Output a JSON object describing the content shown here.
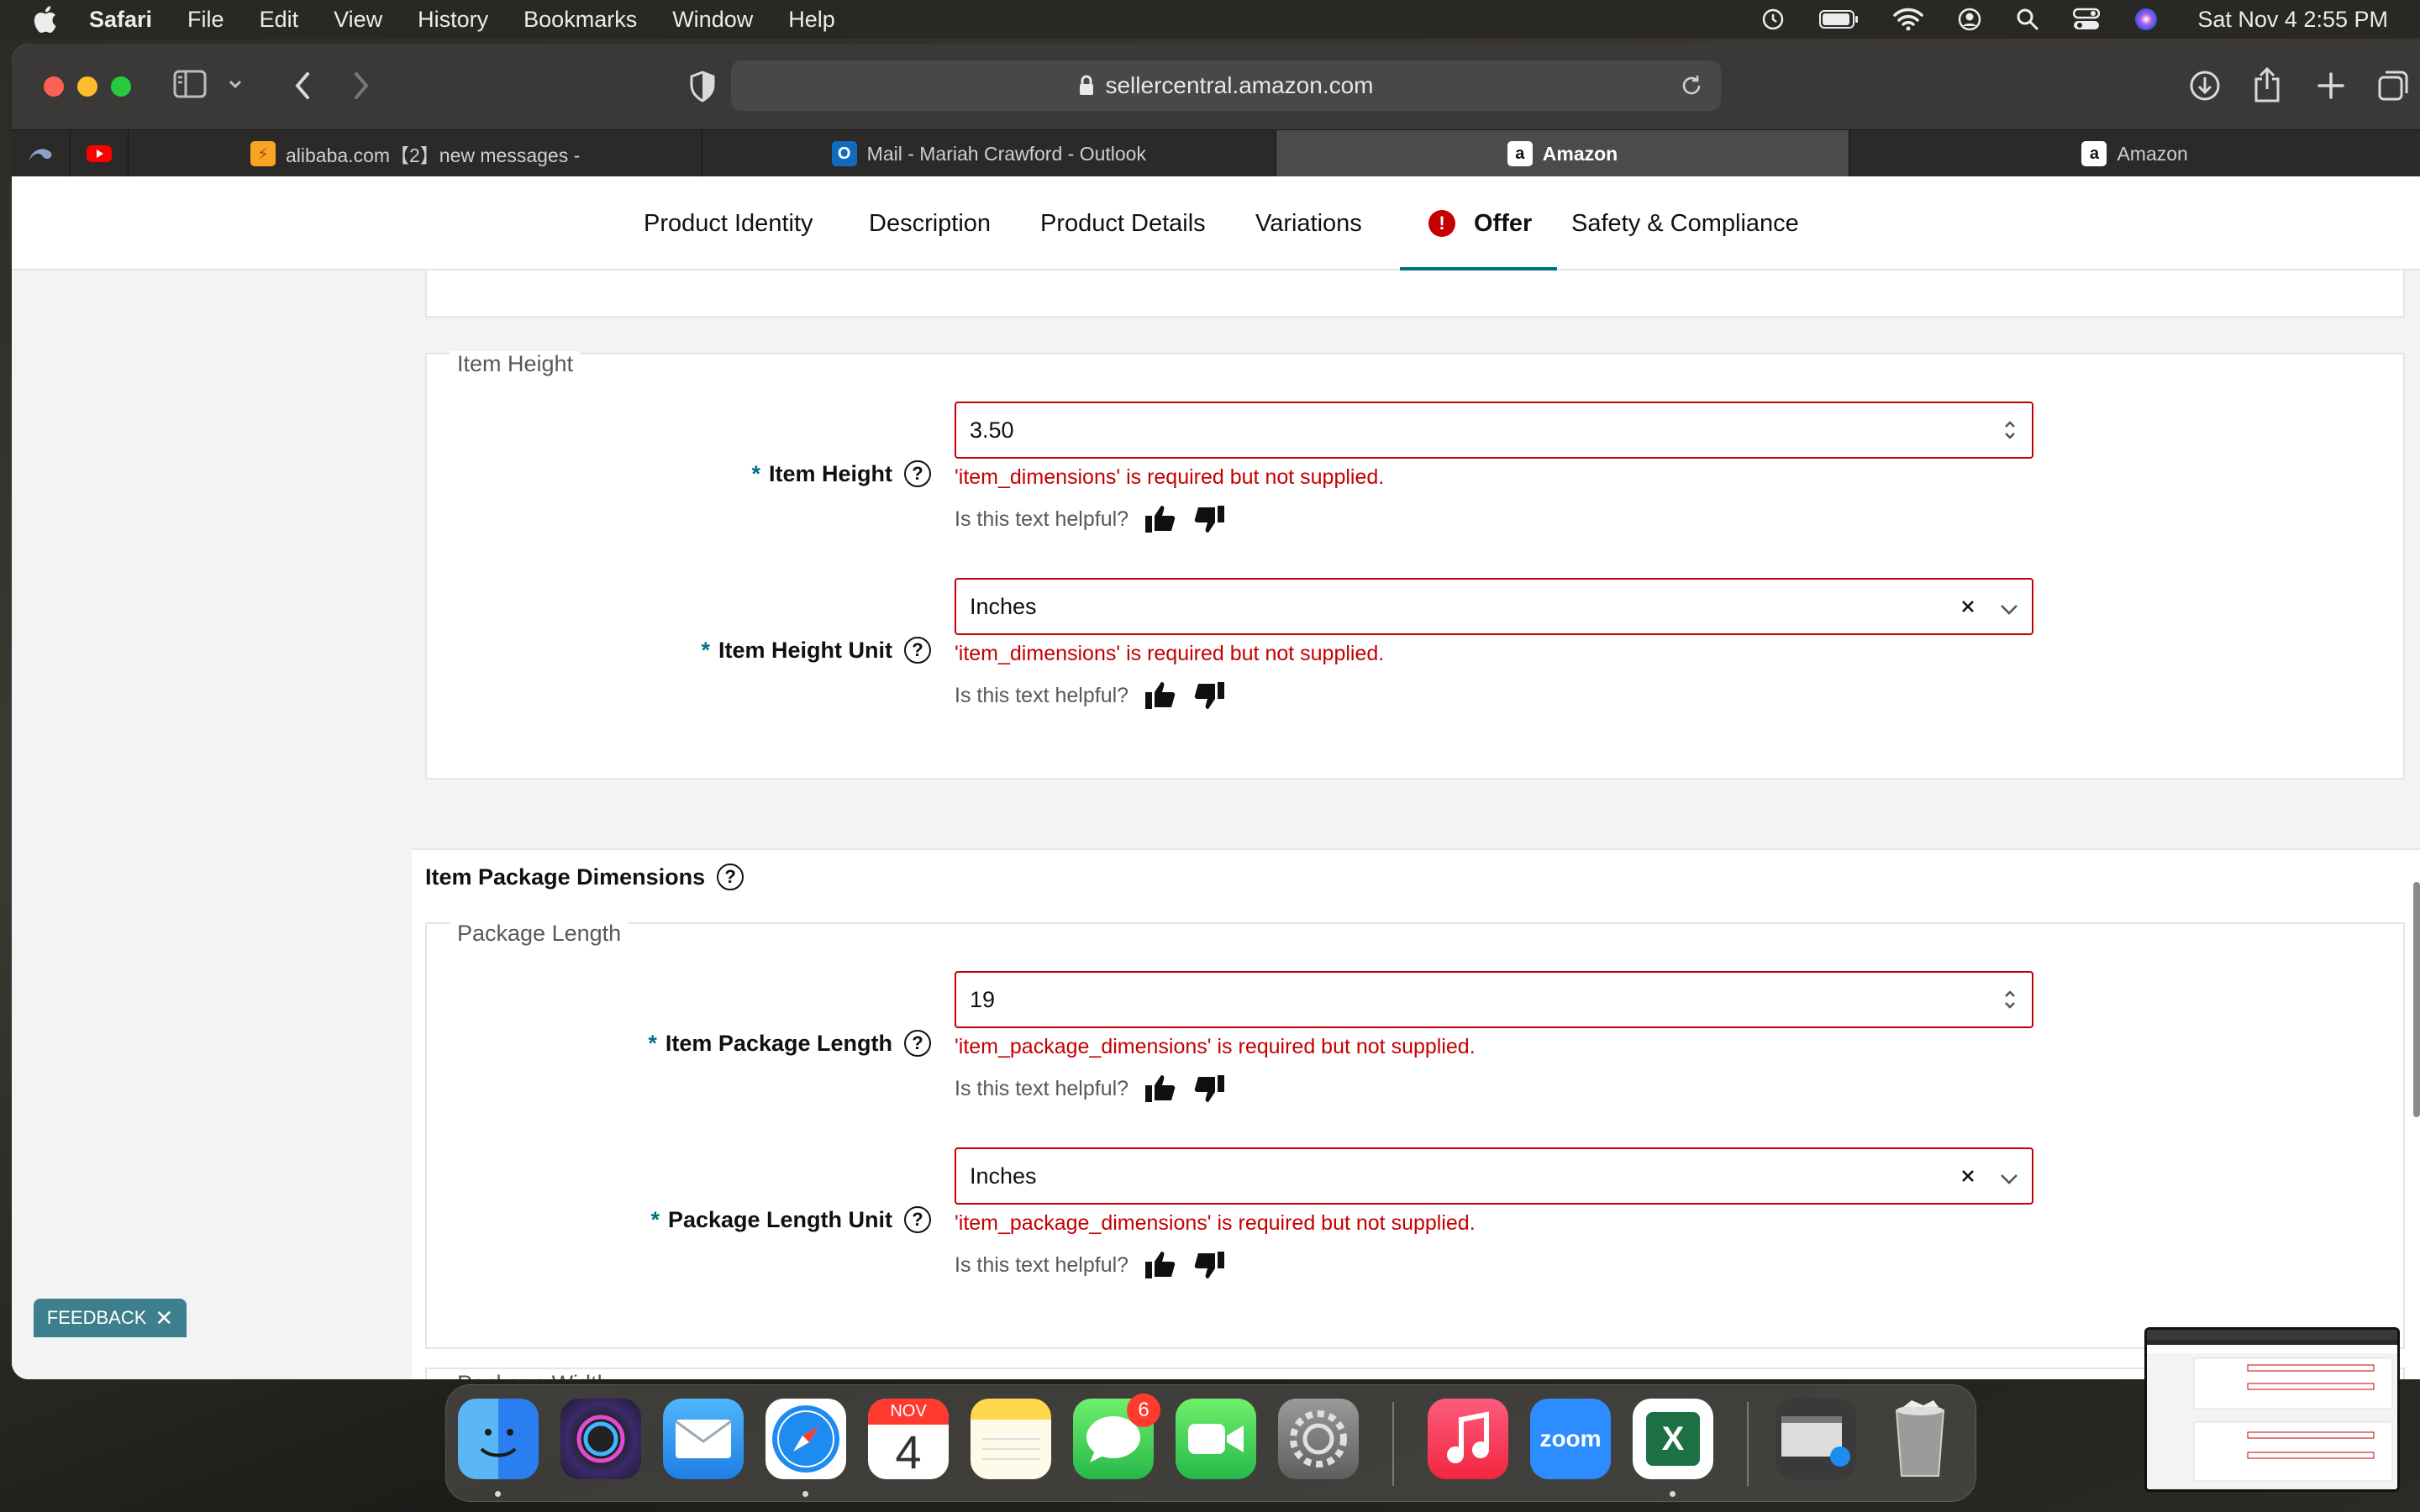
{
  "menubar": {
    "items": [
      "Safari",
      "File",
      "Edit",
      "View",
      "History",
      "Bookmarks",
      "Window",
      "Help"
    ],
    "clock": "Sat Nov 4  2:55 PM"
  },
  "browser": {
    "url": "sellercentral.amazon.com",
    "tabs": [
      {
        "title": "alibaba.com【2】new messages -"
      },
      {
        "title": "Mail - Mariah Crawford - Outlook"
      },
      {
        "title": "Amazon"
      },
      {
        "title": "Amazon"
      }
    ]
  },
  "nav": {
    "tabs": [
      "Product Identity",
      "Description",
      "Product Details",
      "Variations",
      "Offer",
      "Safety & Compliance"
    ],
    "error_mark": "!"
  },
  "item_height_group": {
    "legend": "Item Height",
    "height": {
      "required": "*",
      "label": "Item Height",
      "value": "3.50",
      "error": "'item_dimensions' is required but not supplied.",
      "helpful": "Is this text helpful?"
    },
    "unit": {
      "required": "*",
      "label": "Item Height Unit",
      "value": "Inches",
      "error": "'item_dimensions' is required but not supplied.",
      "helpful": "Is this text helpful?"
    }
  },
  "package_section": {
    "title": "Item Package Dimensions",
    "legend": "Package Length",
    "length": {
      "required": "*",
      "label": "Item Package Length",
      "value": "19",
      "error": "'item_package_dimensions' is required but not supplied.",
      "helpful": "Is this text helpful?"
    },
    "unit": {
      "required": "*",
      "label": "Package Length Unit",
      "value": "Inches",
      "error": "'item_package_dimensions' is required but not supplied.",
      "helpful": "Is this text helpful?"
    },
    "next_legend": "Package Width"
  },
  "feedback": {
    "label": "FEEDBACK",
    "close": "✕"
  },
  "dock": {
    "calendar_month": "NOV",
    "calendar_day": "4",
    "messages_badge": "6",
    "zoom_label": "zoom",
    "excel_label": "X"
  },
  "colors": {
    "error": "#c40000",
    "accent": "#007185",
    "tab_active": "#4d4b49"
  }
}
